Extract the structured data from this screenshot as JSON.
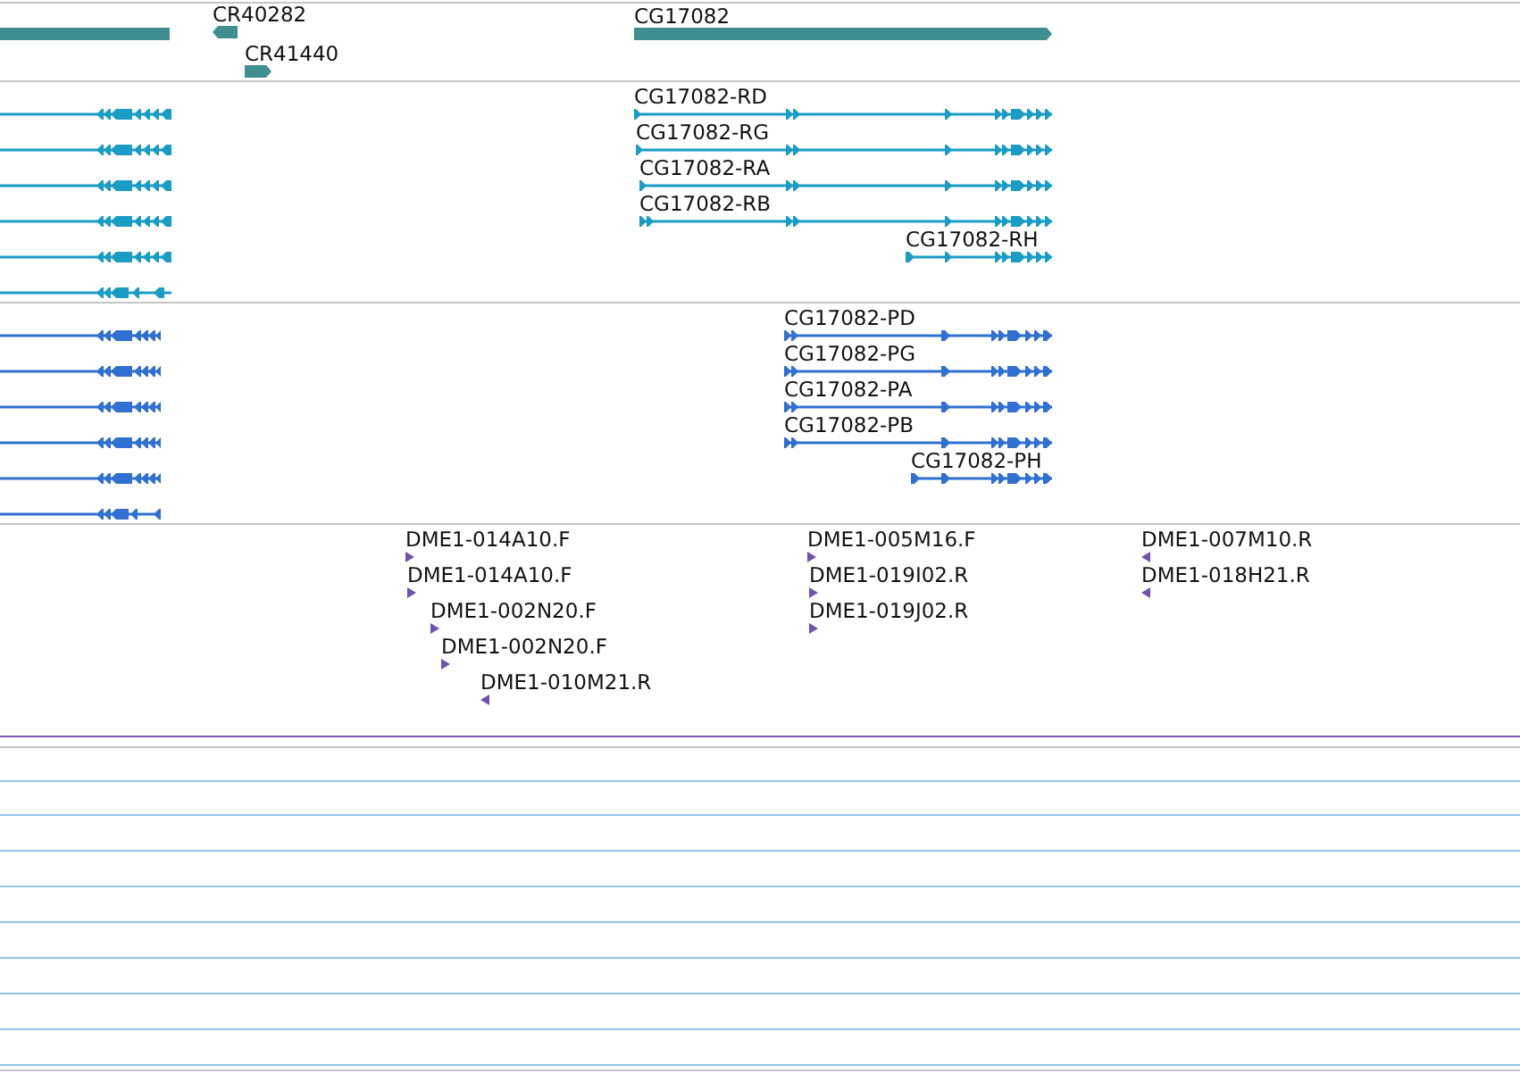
{
  "tracks": [
    {
      "kind": "gene",
      "features": [
        {
          "reverse": true
        },
        {
          "label": "CR40282",
          "reverse": true
        },
        {
          "label": "CR41440",
          "reverse": false
        },
        {
          "label": "CG17082",
          "reverse": false
        }
      ]
    },
    {
      "kind": "transcript",
      "features": [
        {
          "reverse": true
        },
        {
          "reverse": true
        },
        {
          "reverse": true
        },
        {
          "reverse": true
        },
        {
          "reverse": true
        },
        {
          "reverse": true
        },
        {
          "label": "CG17082-RD",
          "reverse": false
        },
        {
          "label": "CG17082-RG",
          "reverse": false
        },
        {
          "label": "CG17082-RA",
          "reverse": false
        },
        {
          "label": "CG17082-RB",
          "reverse": false
        },
        {
          "label": "CG17082-RH",
          "reverse": false
        }
      ]
    },
    {
      "kind": "protein",
      "features": [
        {
          "reverse": true
        },
        {
          "reverse": true
        },
        {
          "reverse": true
        },
        {
          "reverse": true
        },
        {
          "reverse": true
        },
        {
          "reverse": true
        },
        {
          "label": "CG17082-PD",
          "reverse": false
        },
        {
          "label": "CG17082-PG",
          "reverse": false
        },
        {
          "label": "CG17082-PA",
          "reverse": false
        },
        {
          "label": "CG17082-PB",
          "reverse": false
        },
        {
          "label": "CG17082-PH",
          "reverse": false
        }
      ]
    },
    {
      "kind": "clone",
      "features": [
        {
          "label": "DME1-014A10.F",
          "reverse": false
        },
        {
          "label": "DME1-014A10.F",
          "reverse": false
        },
        {
          "label": "DME1-002N20.F",
          "reverse": false
        },
        {
          "label": "DME1-002N20.F",
          "reverse": false
        },
        {
          "label": "DME1-010M21.R",
          "reverse": true
        },
        {
          "label": "DME1-005M16.F",
          "reverse": false
        },
        {
          "label": "DME1-019I02.R",
          "reverse": false
        },
        {
          "label": "DME1-019J02.R",
          "reverse": false
        },
        {
          "label": "DME1-007M10.R",
          "reverse": true
        },
        {
          "label": "DME1-018H21.R",
          "reverse": true
        }
      ]
    }
  ]
}
